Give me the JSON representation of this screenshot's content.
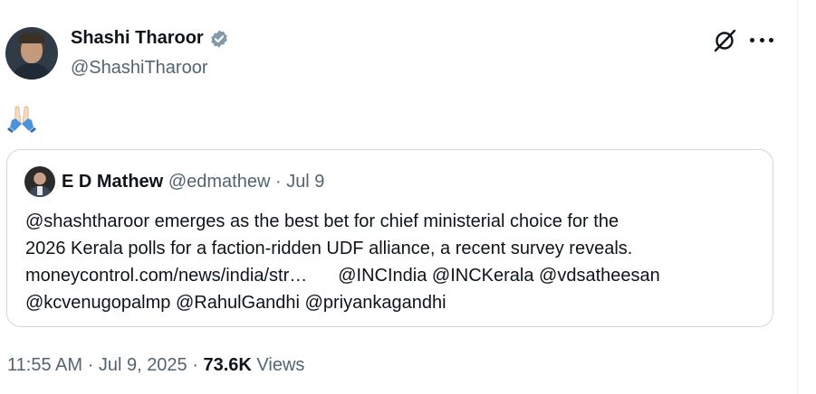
{
  "author": {
    "name": "Shashi Tharoor",
    "handle": "@ShashiTharoor",
    "verified_color": "#1d9bf0"
  },
  "tweet": {
    "emoji": "🙏🏻"
  },
  "quoted": {
    "name": "E D Mathew",
    "handle": "@edmathew",
    "separator": "·",
    "date": "Jul 9",
    "lines": [
      "@shashtharoor emerges as the best bet for chief ministerial choice for the",
      "2026 Kerala polls for a faction-ridden UDF alliance, a recent survey reveals.",
      "moneycontrol.com/news/india/str…",
      "@INCIndia @INCKerala @vdsatheesan",
      "@kcvenugopalmp @RahulGandhi @priyankagandhi"
    ]
  },
  "meta": {
    "time": "11:55 AM",
    "separator": "·",
    "date": "Jul 9, 2025",
    "views_count": "73.6K",
    "views_label": "Views"
  },
  "icons": {
    "grok": "grok-icon",
    "more": "more-icon"
  }
}
